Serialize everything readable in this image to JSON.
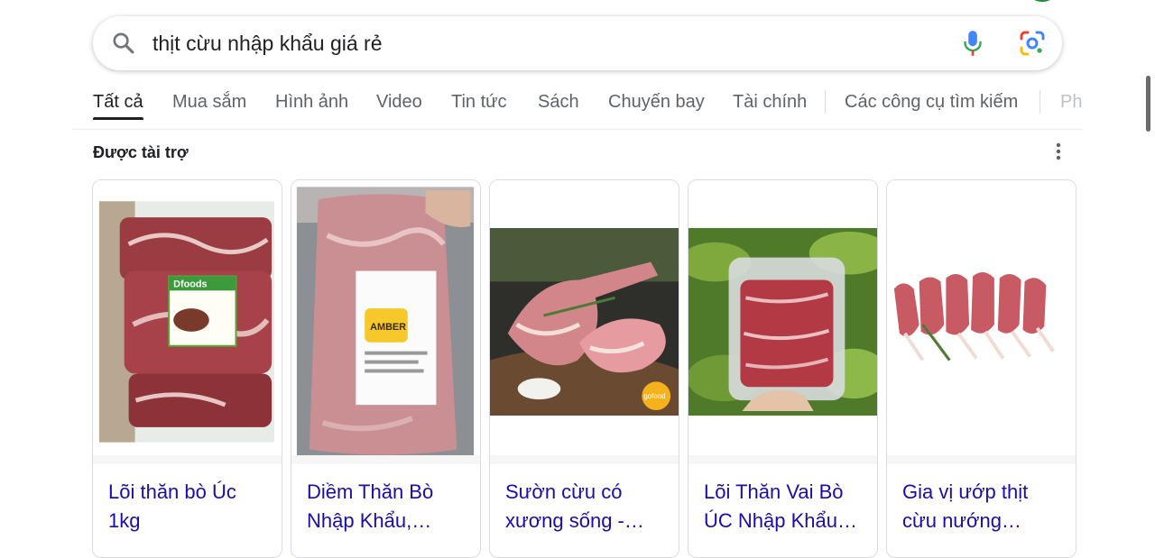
{
  "search": {
    "query": "thịt cừu nhập khẩu giá rẻ"
  },
  "tabs": [
    {
      "label": "Tất cả",
      "active": true
    },
    {
      "label": "Mua sắm"
    },
    {
      "label": "Hình ảnh"
    },
    {
      "label": "Video"
    },
    {
      "label": "Tin tức"
    },
    {
      "label": "Sách"
    },
    {
      "label": "Chuyến bay"
    },
    {
      "label": "Tài chính"
    },
    {
      "label": "Các công cụ tìm kiếm"
    },
    {
      "label": "Ph"
    }
  ],
  "sponsored": {
    "label": "Được tài trợ"
  },
  "products": [
    {
      "title": "Lõi thăn bò Úc 1kg",
      "label_text": "Dfoods"
    },
    {
      "title": "Diềm Thăn Bò Nhập Khẩu,…",
      "label_text": "AMBER"
    },
    {
      "title": "Sườn cừu có xương sống -…",
      "label_text": "gofood"
    },
    {
      "title": "Lõi Thăn Vai Bò ÚC Nhập Khẩu…"
    },
    {
      "title": "Gia vị ướp thịt cừu nướng…"
    }
  ],
  "colors": {
    "link": "#1a0dab",
    "text": "#202124",
    "muted": "#5f6368",
    "mic_blue": "#4285f4",
    "mic_red": "#ea4335",
    "lens_yellow": "#fbbc04",
    "lens_green": "#34a853"
  },
  "icons": [
    "search-icon",
    "mic-icon",
    "lens-icon",
    "more-vert-icon"
  ]
}
